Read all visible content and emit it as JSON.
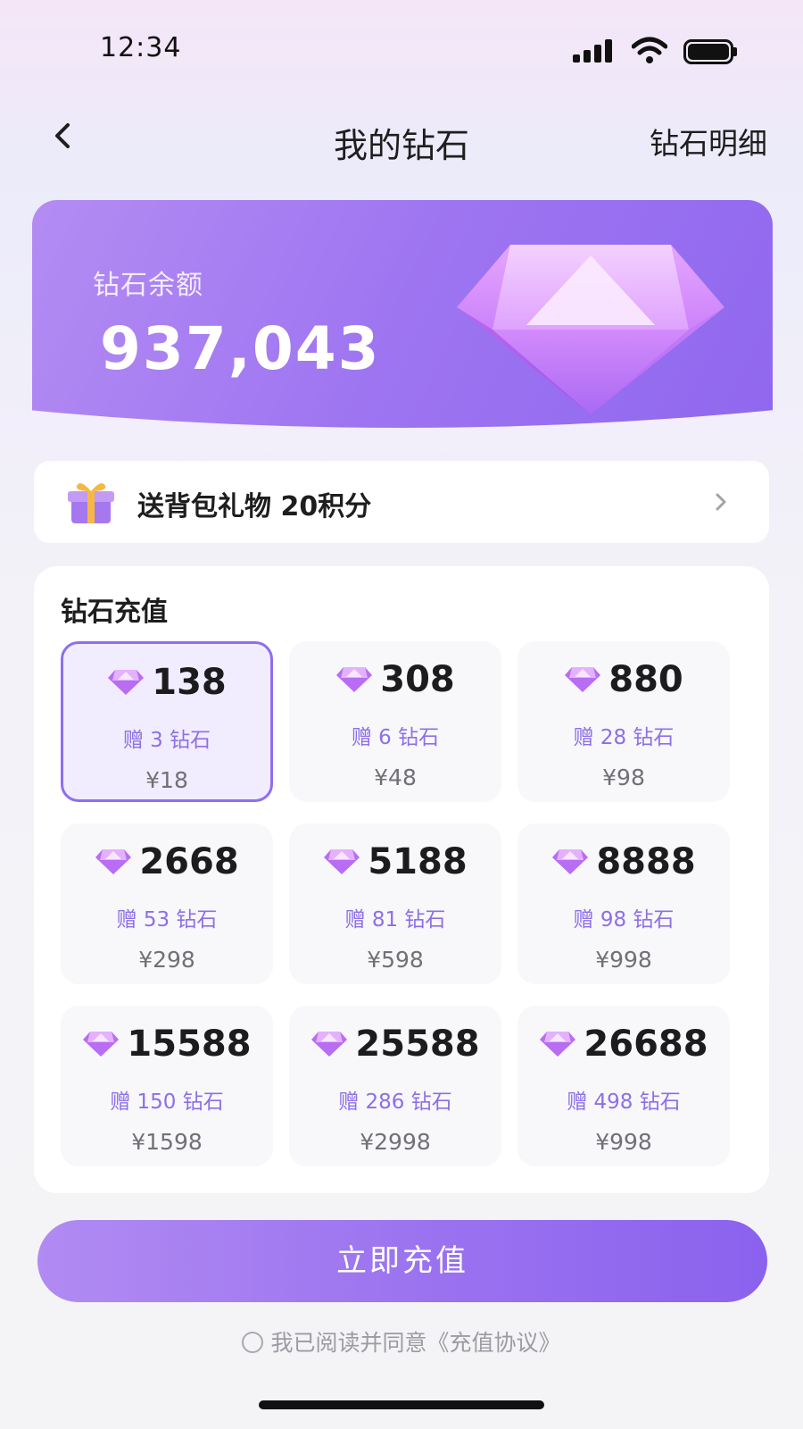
{
  "status_bar": {
    "time": "12:34"
  },
  "nav": {
    "title": "我的钻石",
    "right_link": "钻石明细"
  },
  "balance": {
    "label": "钻石余额",
    "value": "937,043"
  },
  "gift_banner": {
    "text": "送背包礼物 20积分"
  },
  "recharge": {
    "title": "钻石充值",
    "packages": [
      {
        "amount": "138",
        "bonus": "赠 3 钻石",
        "price": "¥18",
        "selected": true
      },
      {
        "amount": "308",
        "bonus": "赠 6 钻石",
        "price": "¥48",
        "selected": false
      },
      {
        "amount": "880",
        "bonus": "赠 28 钻石",
        "price": "¥98",
        "selected": false
      },
      {
        "amount": "2668",
        "bonus": "赠 53 钻石",
        "price": "¥298",
        "selected": false
      },
      {
        "amount": "5188",
        "bonus": "赠 81 钻石",
        "price": "¥598",
        "selected": false
      },
      {
        "amount": "8888",
        "bonus": "赠 98 钻石",
        "price": "¥998",
        "selected": false
      },
      {
        "amount": "15588",
        "bonus": "赠 150 钻石",
        "price": "¥1598",
        "selected": false
      },
      {
        "amount": "25588",
        "bonus": "赠 286 钻石",
        "price": "¥2998",
        "selected": false
      },
      {
        "amount": "26688",
        "bonus": "赠 498 钻石",
        "price": "¥998",
        "selected": false
      }
    ]
  },
  "pay_button": {
    "label": "立即充值"
  },
  "agreement": {
    "text": "我已阅读并同意《充值协议》"
  },
  "colors": {
    "accent": "#9c74f0",
    "bonus_text": "#8e6fe6",
    "selected_bg": "#f1edff"
  },
  "icons": [
    "back-icon",
    "gift-icon",
    "chevron-right-icon",
    "diamond-icon",
    "signal-icon",
    "wifi-icon",
    "battery-icon"
  ]
}
